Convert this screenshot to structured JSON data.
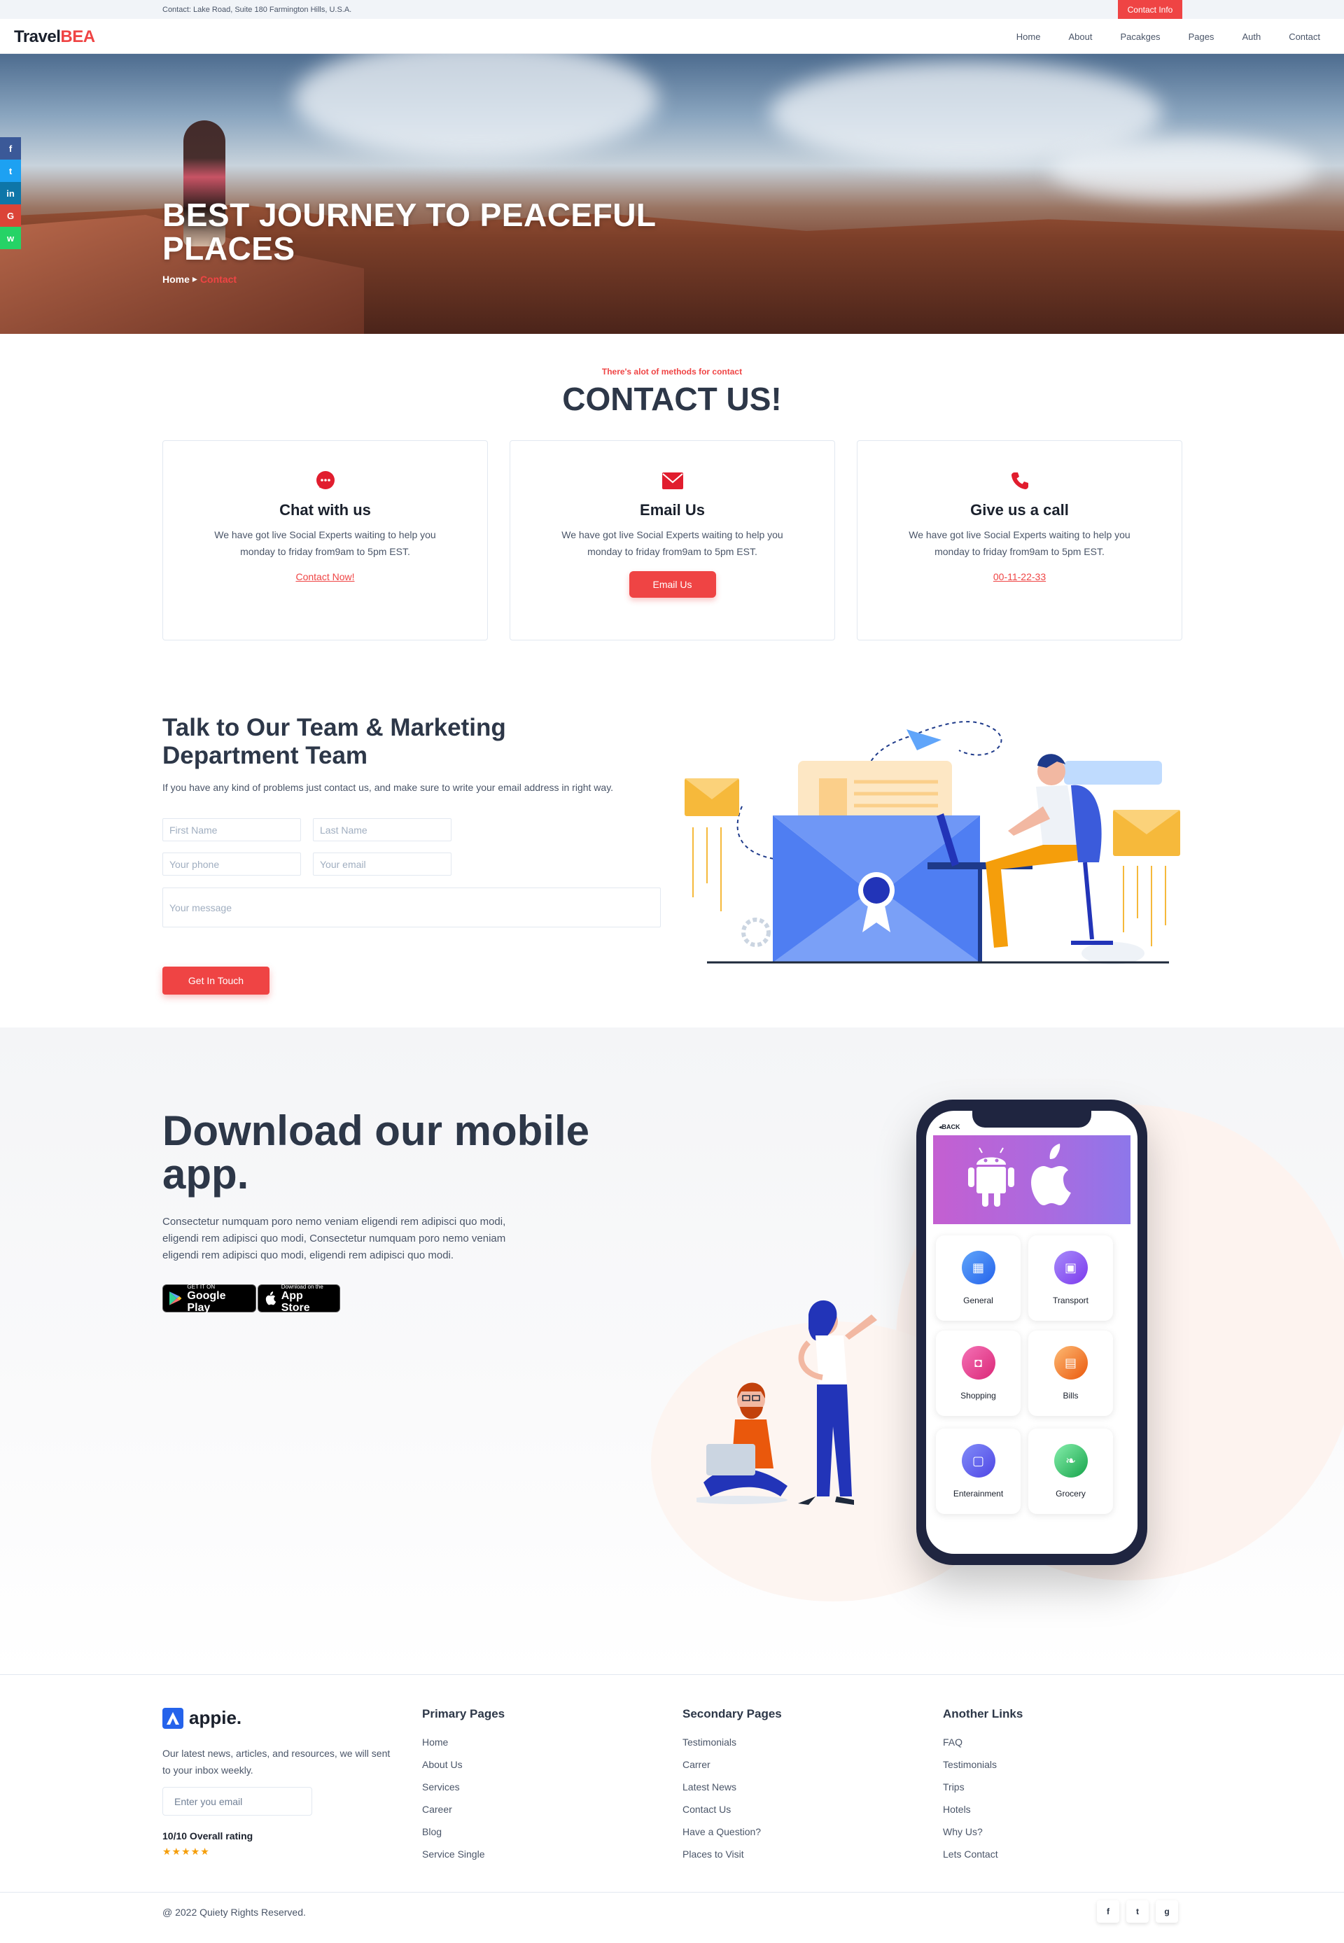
{
  "topbar": {
    "address": "Contact: Lake Road, Suite 180 Farmington Hills, U.S.A.",
    "contact_info_label": "Contact Info"
  },
  "header": {
    "logo_main": "Travel",
    "logo_accent": "BEA",
    "nav": [
      "Home",
      "About",
      "Pacakges",
      "Pages",
      "Auth",
      "Contact"
    ]
  },
  "hero": {
    "title": "BEST JOURNEY TO PEACEFUL PLACES",
    "breadcrumb_home": "Home",
    "breadcrumb_current": "Contact"
  },
  "social_sidebar": [
    {
      "icon": "facebook-icon",
      "glyph": "f",
      "color": "#3b5998"
    },
    {
      "icon": "twitter-icon",
      "glyph": "t",
      "color": "#1da1f2"
    },
    {
      "icon": "linkedin-icon",
      "glyph": "in",
      "color": "#0e76a8"
    },
    {
      "icon": "google-icon",
      "glyph": "G",
      "color": "#db4437"
    },
    {
      "icon": "whatsapp-icon",
      "glyph": "w",
      "color": "#25d366"
    }
  ],
  "contact": {
    "eyebrow": "There's alot of methods for contact",
    "title": "CONTACT US!",
    "cards": [
      {
        "icon": "chat-bubble-icon",
        "title": "Chat with us",
        "text": "We have got live Social Experts waiting to help you monday to friday from9am to 5pm EST.",
        "action": "Contact Now!"
      },
      {
        "icon": "mail-icon",
        "title": "Email Us",
        "text": "We have got live Social Experts waiting to help you monday to friday from9am to 5pm EST.",
        "action": "Email Us"
      },
      {
        "icon": "phone-icon",
        "title": "Give us a call",
        "text": "We have got live Social Experts waiting to help you monday to friday from9am to 5pm EST.",
        "action": "00-11-22-33"
      }
    ]
  },
  "form": {
    "title": "Talk to Our Team & Marketing Department Team",
    "description": "If you have any kind of problems just contact us, and make sure to write your email address in right way.",
    "first_name_placeholder": "First Name",
    "last_name_placeholder": "Last Name",
    "phone_placeholder": "Your phone",
    "email_placeholder": "Your email",
    "message_placeholder": "Your message",
    "submit_label": "Get In Touch"
  },
  "app": {
    "title": "Download our mobile app.",
    "description": "Consectetur numquam poro nemo veniam eligendi rem adipisci quo modi, eligendi rem adipisci quo modi, Consectetur numquam poro nemo veniam eligendi rem adipisci quo modi, eligendi rem adipisci quo modi.",
    "google_play_small": "GET IT ON",
    "google_play_big": "Google Play",
    "app_store_small": "Download on the",
    "app_store_big": "App Store",
    "phone_back": "BACK",
    "tiles": [
      {
        "label": "General",
        "icon": "grid-icon",
        "color": "#3b82f6"
      },
      {
        "label": "Transport",
        "icon": "bus-icon",
        "color": "#8b5cf6"
      },
      {
        "label": "Shopping",
        "icon": "bag-icon",
        "color": "#ec4899"
      },
      {
        "label": "Bills",
        "icon": "receipt-icon",
        "color": "#f97316"
      },
      {
        "label": "Enterainment",
        "icon": "tv-icon",
        "color": "#6366f1"
      },
      {
        "label": "Grocery",
        "icon": "leaf-icon",
        "color": "#22c55e"
      }
    ]
  },
  "footer": {
    "logo": "appie.",
    "text": "Our latest news, articles, and resources, we will sent to your inbox weekly.",
    "email_placeholder": "Enter you email",
    "rating": "10/10 Overall rating",
    "stars": "★★★★★",
    "col1": {
      "title": "Primary Pages",
      "links": [
        "Home",
        "About Us",
        "Services",
        "Career",
        "Blog",
        "Service Single"
      ]
    },
    "col2": {
      "title": "Secondary Pages",
      "links": [
        "Testimonials",
        "Carrer",
        "Latest News",
        "Contact Us",
        "Have a Question?",
        "Places to Visit"
      ]
    },
    "col3": {
      "title": "Another Links",
      "links": [
        "FAQ",
        "Testimonials",
        "Trips",
        "Hotels",
        "Why Us?",
        "Lets Contact"
      ]
    },
    "copyright": "@ 2022 Quiety Rights Reserved.",
    "social": [
      {
        "icon": "facebook-icon",
        "glyph": "f"
      },
      {
        "icon": "twitter-icon",
        "glyph": "t"
      },
      {
        "icon": "github-icon",
        "glyph": "g"
      }
    ]
  },
  "colors": {
    "accent": "#ef4444",
    "dark": "#2d3748",
    "phone": "#1f2540"
  }
}
